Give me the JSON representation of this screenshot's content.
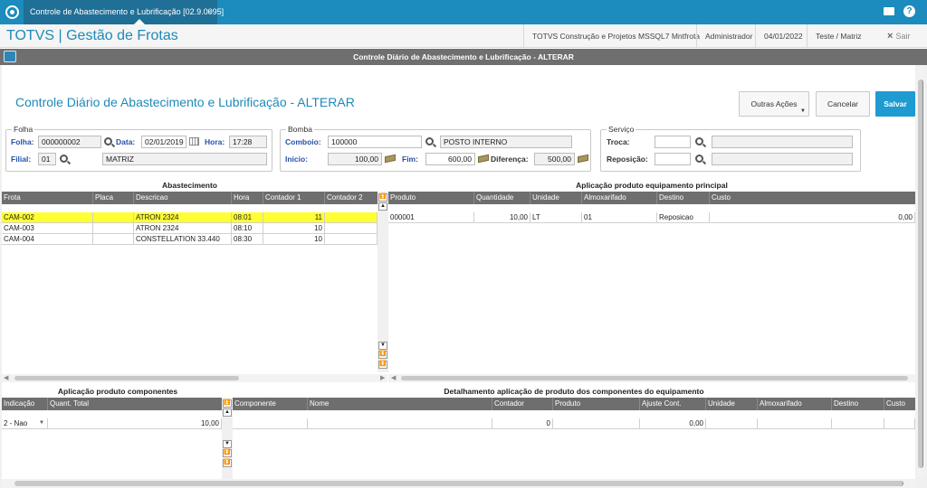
{
  "tab": {
    "title": "Controle de Abastecimento e Lubrificação [02.9.0095]",
    "close": "×"
  },
  "header": {
    "app_title": "TOTVS | Gestão de Frotas",
    "company": "TOTVS Construção e Projetos MSSQL7 Mntfrota",
    "user": "Administrador",
    "date": "04/01/2022",
    "branch": "Teste / Matriz",
    "exit_icon": "×",
    "exit_label": "Sair"
  },
  "window": {
    "title": "Controle Diário de Abastecimento e Lubrificação - ALTERAR"
  },
  "form": {
    "title": "Controle Diário de Abastecimento e Lubrificação - ALTERAR",
    "buttons": {
      "outras_acoes": "Outras Ações",
      "cancelar": "Cancelar",
      "salvar": "Salvar"
    }
  },
  "folha": {
    "group_label": "Folha",
    "folha_label": "Folha:",
    "folha_value": "000000002",
    "data_label": "Data:",
    "data_value": "02/01/2019",
    "hora_label": "Hora:",
    "hora_value": "17:28",
    "filial_label": "Filial:",
    "filial_value": "01",
    "filial_desc": "MATRIZ"
  },
  "bomba": {
    "group_label": "Bomba",
    "comboio_label": "Comboio:",
    "comboio_value": "100000",
    "comboio_desc": "POSTO INTERNO",
    "inicio_label": "Inicio:",
    "inicio_value": "100,00",
    "fim_label": "Fim:",
    "fim_value": "600,00",
    "diferenca_label": "Diferença:",
    "diferenca_value": "500,00"
  },
  "servico": {
    "group_label": "Serviço",
    "troca_label": "Troca:",
    "reposicao_label": "Reposição:"
  },
  "abastecimento": {
    "title": "Abastecimento",
    "columns": [
      "Frota",
      "Placa",
      "Descricao",
      "Hora",
      "Contador 1",
      "Contador 2"
    ],
    "rows": [
      [
        "CAM-002",
        "",
        "ATRON 2324",
        "08:01",
        "11",
        ""
      ],
      [
        "CAM-003",
        "",
        "ATRON 2324",
        "08:10",
        "10",
        ""
      ],
      [
        "CAM-004",
        "",
        "CONSTELLATION 33.440",
        "08:30",
        "10",
        ""
      ]
    ]
  },
  "aplicacao_principal": {
    "title": "Aplicação produto equipamento principal",
    "columns": [
      "Produto",
      "Quantidade",
      "Unidade",
      "Almoxarifado",
      "Destino",
      "Custo"
    ],
    "rows": [
      [
        "000001",
        "10,00",
        "LT",
        "01",
        "Reposicao",
        "0,00"
      ]
    ]
  },
  "aplicacao_componentes": {
    "title": "Aplicação produto componentes",
    "columns": [
      "Indicação",
      "Quant. Total"
    ],
    "rows": [
      [
        "2 - Nao",
        "10,00"
      ]
    ]
  },
  "detalhamento": {
    "title": "Detalhamento aplicação de produto dos componentes do equipamento",
    "columns": [
      "Componente",
      "Nome",
      "Contador",
      "Produto",
      "Ajuste Cont.",
      "Unidade",
      "Almoxarifado",
      "Destino",
      "Custo"
    ],
    "rows": [
      [
        "",
        "",
        "0",
        "",
        "0,00",
        "",
        "",
        "",
        ""
      ]
    ]
  },
  "nav": {
    "top": "⏫",
    "up": "▲",
    "down": "▼",
    "bottom": "⏬"
  },
  "scroll": {
    "left": "◀",
    "right": "▶"
  },
  "icons": {
    "home": "totvs-logo-icon",
    "mail": "mail-icon",
    "help": "help-icon"
  }
}
